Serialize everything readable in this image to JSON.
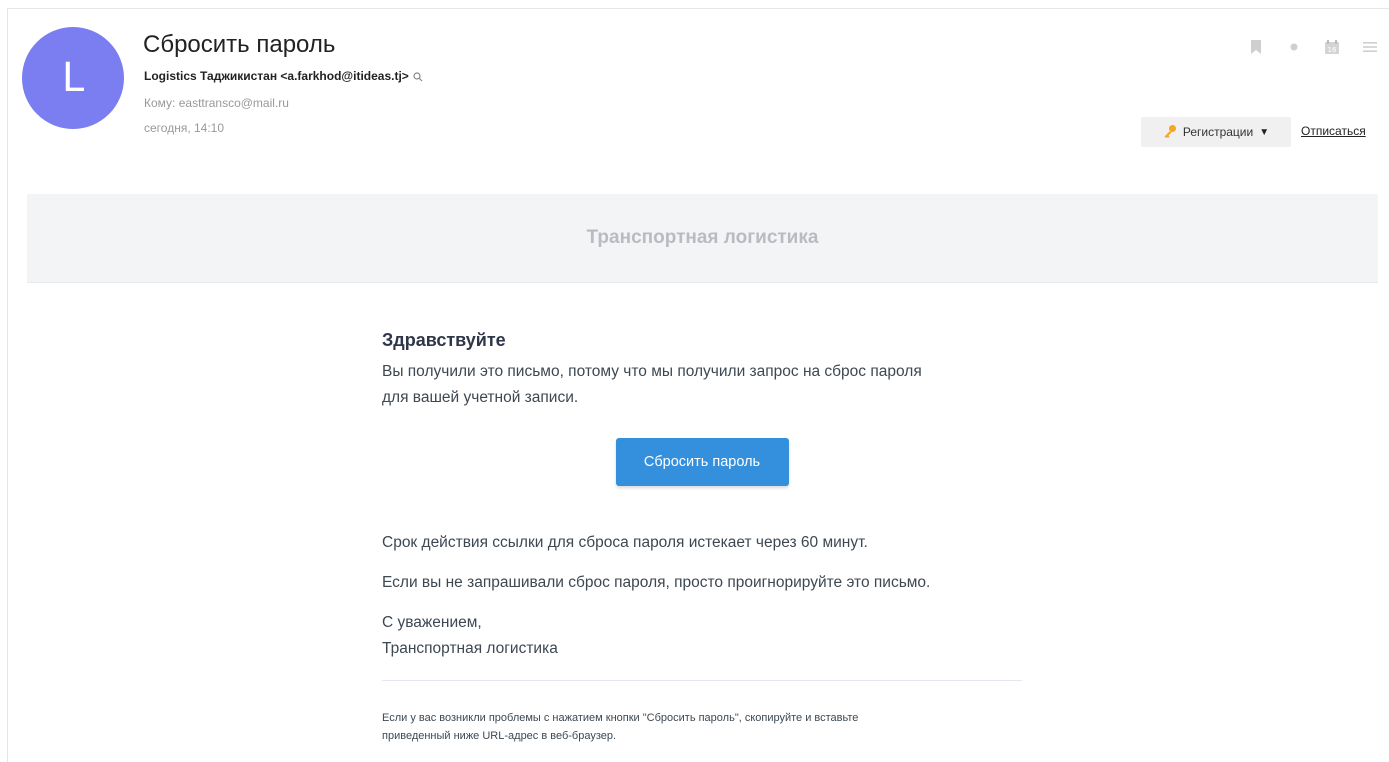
{
  "email": {
    "avatar_letter": "L",
    "subject": "Сбросить пароль",
    "sender": "Logistics Таджикистан <a.farkhod@itideas.tj>",
    "to": "Кому: easttransco@mail.ru",
    "date": "сегодня, 14:10"
  },
  "toolbar": {
    "calendar_day": "16",
    "registrations_label": "Регистрации",
    "unsubscribe_label": "Отписаться"
  },
  "body": {
    "banner_title": "Транспортная логистика",
    "greeting": "Здравствуйте",
    "intro_line1": "Вы получили это письмо, потому что мы получили запрос на сброс пароля",
    "intro_line2": "для вашей учетной записи.",
    "reset_button": "Сбросить пароль",
    "expiry": "Срок действия ссылки для сброса пароля истекает через 60 минут.",
    "ignore": "Если вы не запрашивали сброс пароля, просто проигнорируйте это письмо.",
    "regards": "С уважением,",
    "signature": "Транспортная логистика",
    "footer_line1": "Если у вас возникли проблемы с нажатием кнопки \"Сбросить пароль\", скопируйте и вставьте",
    "footer_line2": "приведенный ниже URL-адрес в веб-браузер."
  },
  "icons": {
    "bookmark": "bookmark-icon",
    "dot": "unread-dot-icon",
    "calendar": "calendar-icon",
    "menu": "menu-icon",
    "key": "key-icon",
    "search": "search-icon"
  },
  "colors": {
    "avatar": "#7b7ef0",
    "button": "#3490dc",
    "banner_bg": "#f3f4f6",
    "banner_text": "#b8bcc2"
  }
}
